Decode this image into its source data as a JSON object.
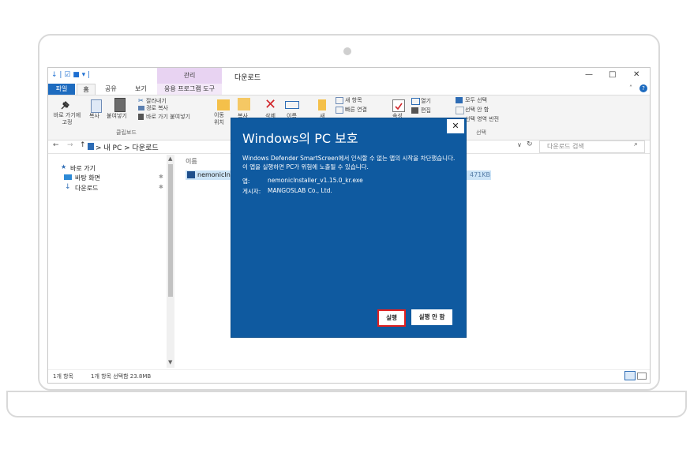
{
  "explorer": {
    "quick_access_icons": "↓ | ☑ ■ ▾ |",
    "context_tab_header": "관리",
    "window_title": "다운로드",
    "window_buttons": {
      "minimize": "—",
      "maximize": "□",
      "close": "✕"
    },
    "tabs": {
      "file": "파일",
      "home": "홈",
      "share": "공유",
      "view": "보기",
      "ctx": "응용 프로그램 도구"
    },
    "help_icon_text": "˄",
    "help_badge": "?",
    "ribbon": {
      "pin_label_1": "바로 가기에",
      "pin_label_2": "고정",
      "copy_label": "복사",
      "paste_label": "붙여넣기",
      "cut_label": "잘라내기",
      "copy_path_label": "경로 복사",
      "paste_shortcut_label": "바로 가기 붙여넣기",
      "clipboard_group": "클립보드",
      "move_label_1": "이동",
      "move_label_2": "위치",
      "copy_to_label": "복사",
      "delete_label": "삭제",
      "rename_label": "이름",
      "new_folder_label": "새",
      "new_item_label": "새 항목",
      "easy_access_label": "빠른 연결",
      "properties_label": "속성",
      "open_label": "열기",
      "edit_label": "편집",
      "select_all_label": "모두 선택",
      "select_none_label": "선택 안 함",
      "invert_selection_label": "선택 영역 반전",
      "select_group": "선택"
    },
    "address": {
      "back": "←",
      "forward": "→",
      "up": "↑",
      "path": "> 내 PC > 다운로드",
      "dropdown": "∨",
      "refresh": "↻"
    },
    "search_placeholder": "다운로드 검색",
    "search_icon": "⌕",
    "nav": {
      "quick_access": "바로 가기",
      "desktop": "바탕 화면",
      "downloads": "다운로드"
    },
    "list": {
      "col_name": "이름",
      "file_name": "nemonicIn",
      "file_size": "471KB"
    },
    "status": {
      "count": "1개 항목",
      "selected": "1개 항목 선택함 23.8MB"
    }
  },
  "dialog": {
    "title": "Windows의 PC 보호",
    "close": "✕",
    "message": "Windows Defender SmartScreen에서 인식할 수 없는 앱의 시작을 차단했습니다. 이 앱을 실행하면 PC가 위험에 노출될 수 있습니다.",
    "app_label": "앱:",
    "app_value": "nemonicInstaller_v1.15.0_kr.exe",
    "publisher_label": "게시자:",
    "publisher_value": "MANGOSLAB Co., Ltd.",
    "run_button": "실행",
    "dont_run_button": "실행 안 함"
  },
  "colors": {
    "dialog_bg": "#0f5aa0",
    "accent": "#1d6bbf",
    "run_border": "#e02020"
  }
}
